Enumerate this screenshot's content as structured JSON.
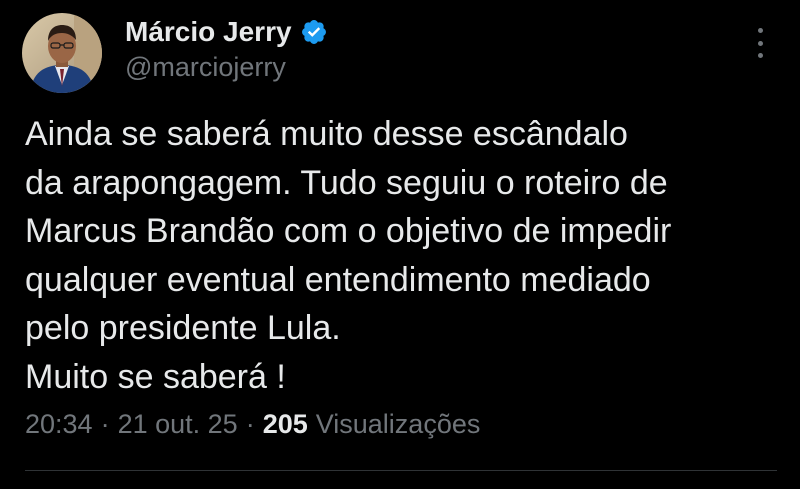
{
  "author": {
    "display_name": "Márcio Jerry",
    "handle": "@marciojerry",
    "verified": true,
    "verified_icon": "verified-badge-icon",
    "verified_color": "#1d9bf0"
  },
  "menu": {
    "icon": "more-options-icon"
  },
  "tweet": {
    "lines": [
      "Ainda se saberá muito desse escândalo",
      "da arapongagem. Tudo seguiu o roteiro de",
      "Marcus Brandão com o objetivo de impedir",
      "qualquer eventual entendimento mediado",
      "pelo presidente Lula.",
      "Muito se saberá !"
    ]
  },
  "meta": {
    "time": "20:34",
    "separator": "·",
    "date": "21 out. 25",
    "views_count": "205",
    "views_label": "Visualizações"
  },
  "colors": {
    "background": "#000000",
    "text_primary": "#e7e9ea",
    "text_secondary": "#71767b",
    "divider": "#2f3336"
  }
}
